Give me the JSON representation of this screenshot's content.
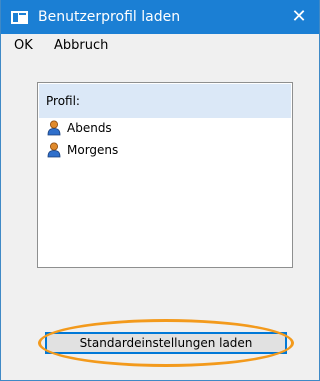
{
  "window": {
    "title": "Benutzerprofil laden",
    "close_glyph": "✕"
  },
  "menubar": {
    "items": [
      {
        "label": "OK"
      },
      {
        "label": "Abbruch"
      }
    ]
  },
  "profile_list": {
    "header": "Profil:",
    "items": [
      {
        "label": "Abends",
        "icon": "user-icon"
      },
      {
        "label": "Morgens",
        "icon": "user-icon"
      }
    ]
  },
  "actions": {
    "load_defaults_label": "Standardeinstellungen laden"
  },
  "colors": {
    "titlebar": "#1b7fd4",
    "list_header": "#dbe8f7",
    "highlight": "#f39a1c",
    "button_focus": "#0078d7"
  }
}
